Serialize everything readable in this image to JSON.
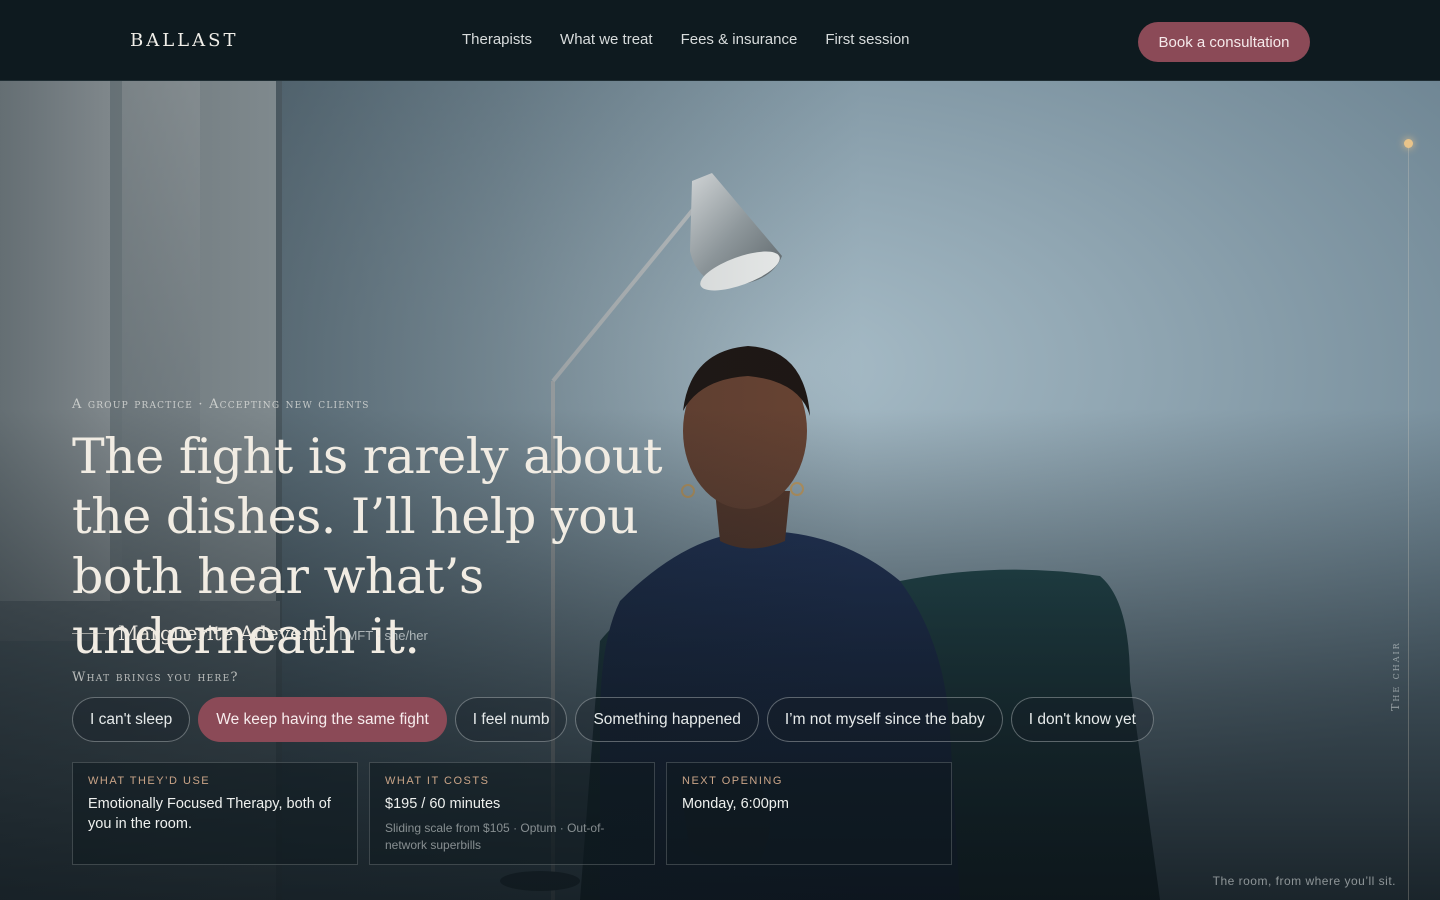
{
  "brand": {
    "logo": "BALLAST"
  },
  "nav": {
    "links": [
      "Therapists",
      "What we treat",
      "Fees & insurance",
      "First session"
    ],
    "cta": "Book a consultation"
  },
  "hero": {
    "eyebrow": "A group practice · Accepting new clients",
    "headline": "The fight is rarely about the dishes. I’ll help you both hear what’s underneath it.",
    "therapist_name": "Marguerite Adeyemi",
    "therapist_credentials": "LMFT · she/her",
    "prompt": "What brings you here?",
    "chips": [
      {
        "label": "I can't sleep",
        "active": false
      },
      {
        "label": "We keep having the same fight",
        "active": true
      },
      {
        "label": "I feel numb",
        "active": false
      },
      {
        "label": "Something happened",
        "active": false
      },
      {
        "label": "I’m not myself since the baby",
        "active": false
      },
      {
        "label": "I don't know yet",
        "active": false
      }
    ],
    "cards": [
      {
        "label": "What they’d use",
        "value": "Emotionally Focused Therapy, both of you in the room.",
        "note": ""
      },
      {
        "label": "What it costs",
        "value": "$195 / 60 minutes",
        "note": "Sliding scale from $105 · Optum · Out-of-network superbills"
      },
      {
        "label": "Next opening",
        "value": "Monday, 6:00pm",
        "note": ""
      }
    ],
    "rail_label": "The chair",
    "caption": "The room, from where you’ll sit."
  },
  "colors": {
    "nav_bg": "#0e1a1f",
    "accent": "#8b4a57",
    "label_gold": "#c9a487",
    "rail_dot": "#e9c48a"
  }
}
